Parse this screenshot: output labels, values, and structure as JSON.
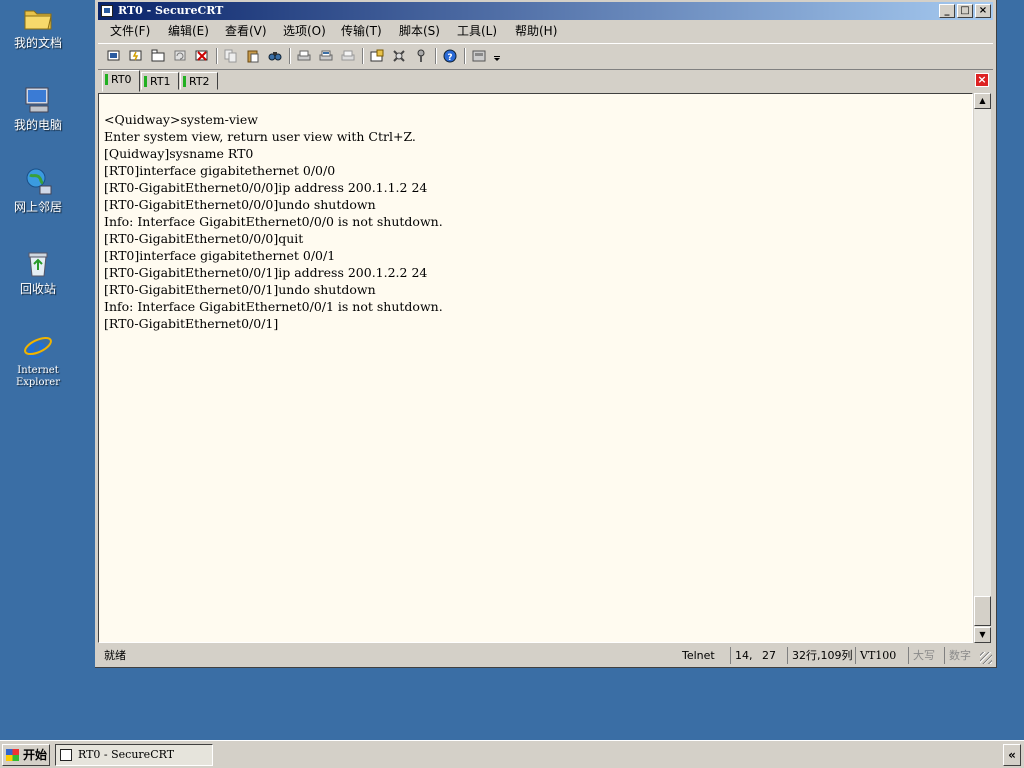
{
  "desktop": {
    "icons": [
      {
        "label": "我的文档",
        "icon": "folder-icon"
      },
      {
        "label": "我的电脑",
        "icon": "computer-icon"
      },
      {
        "label": "网上邻居",
        "icon": "network-icon"
      },
      {
        "label": "回收站",
        "icon": "recycle-bin-icon"
      },
      {
        "label": "Internet Explorer",
        "icon": "ie-icon"
      }
    ],
    "background_color": "#3a6ea5"
  },
  "window": {
    "title": "RT0 - SecureCRT",
    "controls": {
      "minimize": "_",
      "maximize": "□",
      "close": "×"
    },
    "menu": [
      "文件(F)",
      "编辑(E)",
      "查看(V)",
      "选项(O)",
      "传输(T)",
      "脚本(S)",
      "工具(L)",
      "帮助(H)"
    ],
    "toolbar": [
      "connect-icon",
      "quick-connect-icon",
      "connect-in-tab-icon",
      "reconnect-icon",
      "disconnect-icon",
      "copy-icon",
      "paste-icon",
      "find-icon",
      "print-icon",
      "print-selection-icon",
      "print-setup-icon",
      "session-options-icon",
      "global-options-icon",
      "keymap-icon",
      "help-icon",
      "sftp-icon"
    ],
    "tabs": [
      {
        "label": "RT0",
        "active": true
      },
      {
        "label": "RT1",
        "active": false
      },
      {
        "label": "RT2",
        "active": false
      }
    ],
    "tab_close": "×",
    "terminal_lines": [
      "<Quidway>system-view",
      "Enter system view, return user view with Ctrl+Z.",
      "[Quidway]sysname RT0",
      "[RT0]interface gigabitethernet 0/0/0",
      "[RT0-GigabitEthernet0/0/0]ip address 200.1.1.2 24",
      "[RT0-GigabitEthernet0/0/0]undo shutdown",
      "Info: Interface GigabitEthernet0/0/0 is not shutdown.",
      "[RT0-GigabitEthernet0/0/0]quit",
      "[RT0]interface gigabitethernet 0/0/1",
      "[RT0-GigabitEthernet0/0/1]ip address 200.1.2.2 24",
      "[RT0-GigabitEthernet0/0/1]undo shutdown",
      "Info: Interface GigabitEthernet0/0/1 is not shutdown.",
      "[RT0-GigabitEthernet0/0/1]"
    ],
    "status": {
      "ready": "就绪",
      "protocol": "Telnet",
      "cursor_row": "14,",
      "cursor_col": "27",
      "size": "32行,109列",
      "emulation": "VT100",
      "caps": "大写",
      "num": "数字"
    },
    "colors": {
      "terminal_bg": "#fffbf0",
      "title_gradient_start": "#0a246a",
      "title_gradient_end": "#a6caf0",
      "tab_indicator": "#21b021"
    }
  },
  "taskbar": {
    "start_label": "开始",
    "tasks": [
      {
        "label": "RT0 - SecureCRT"
      }
    ],
    "tray_toggle": "«"
  }
}
